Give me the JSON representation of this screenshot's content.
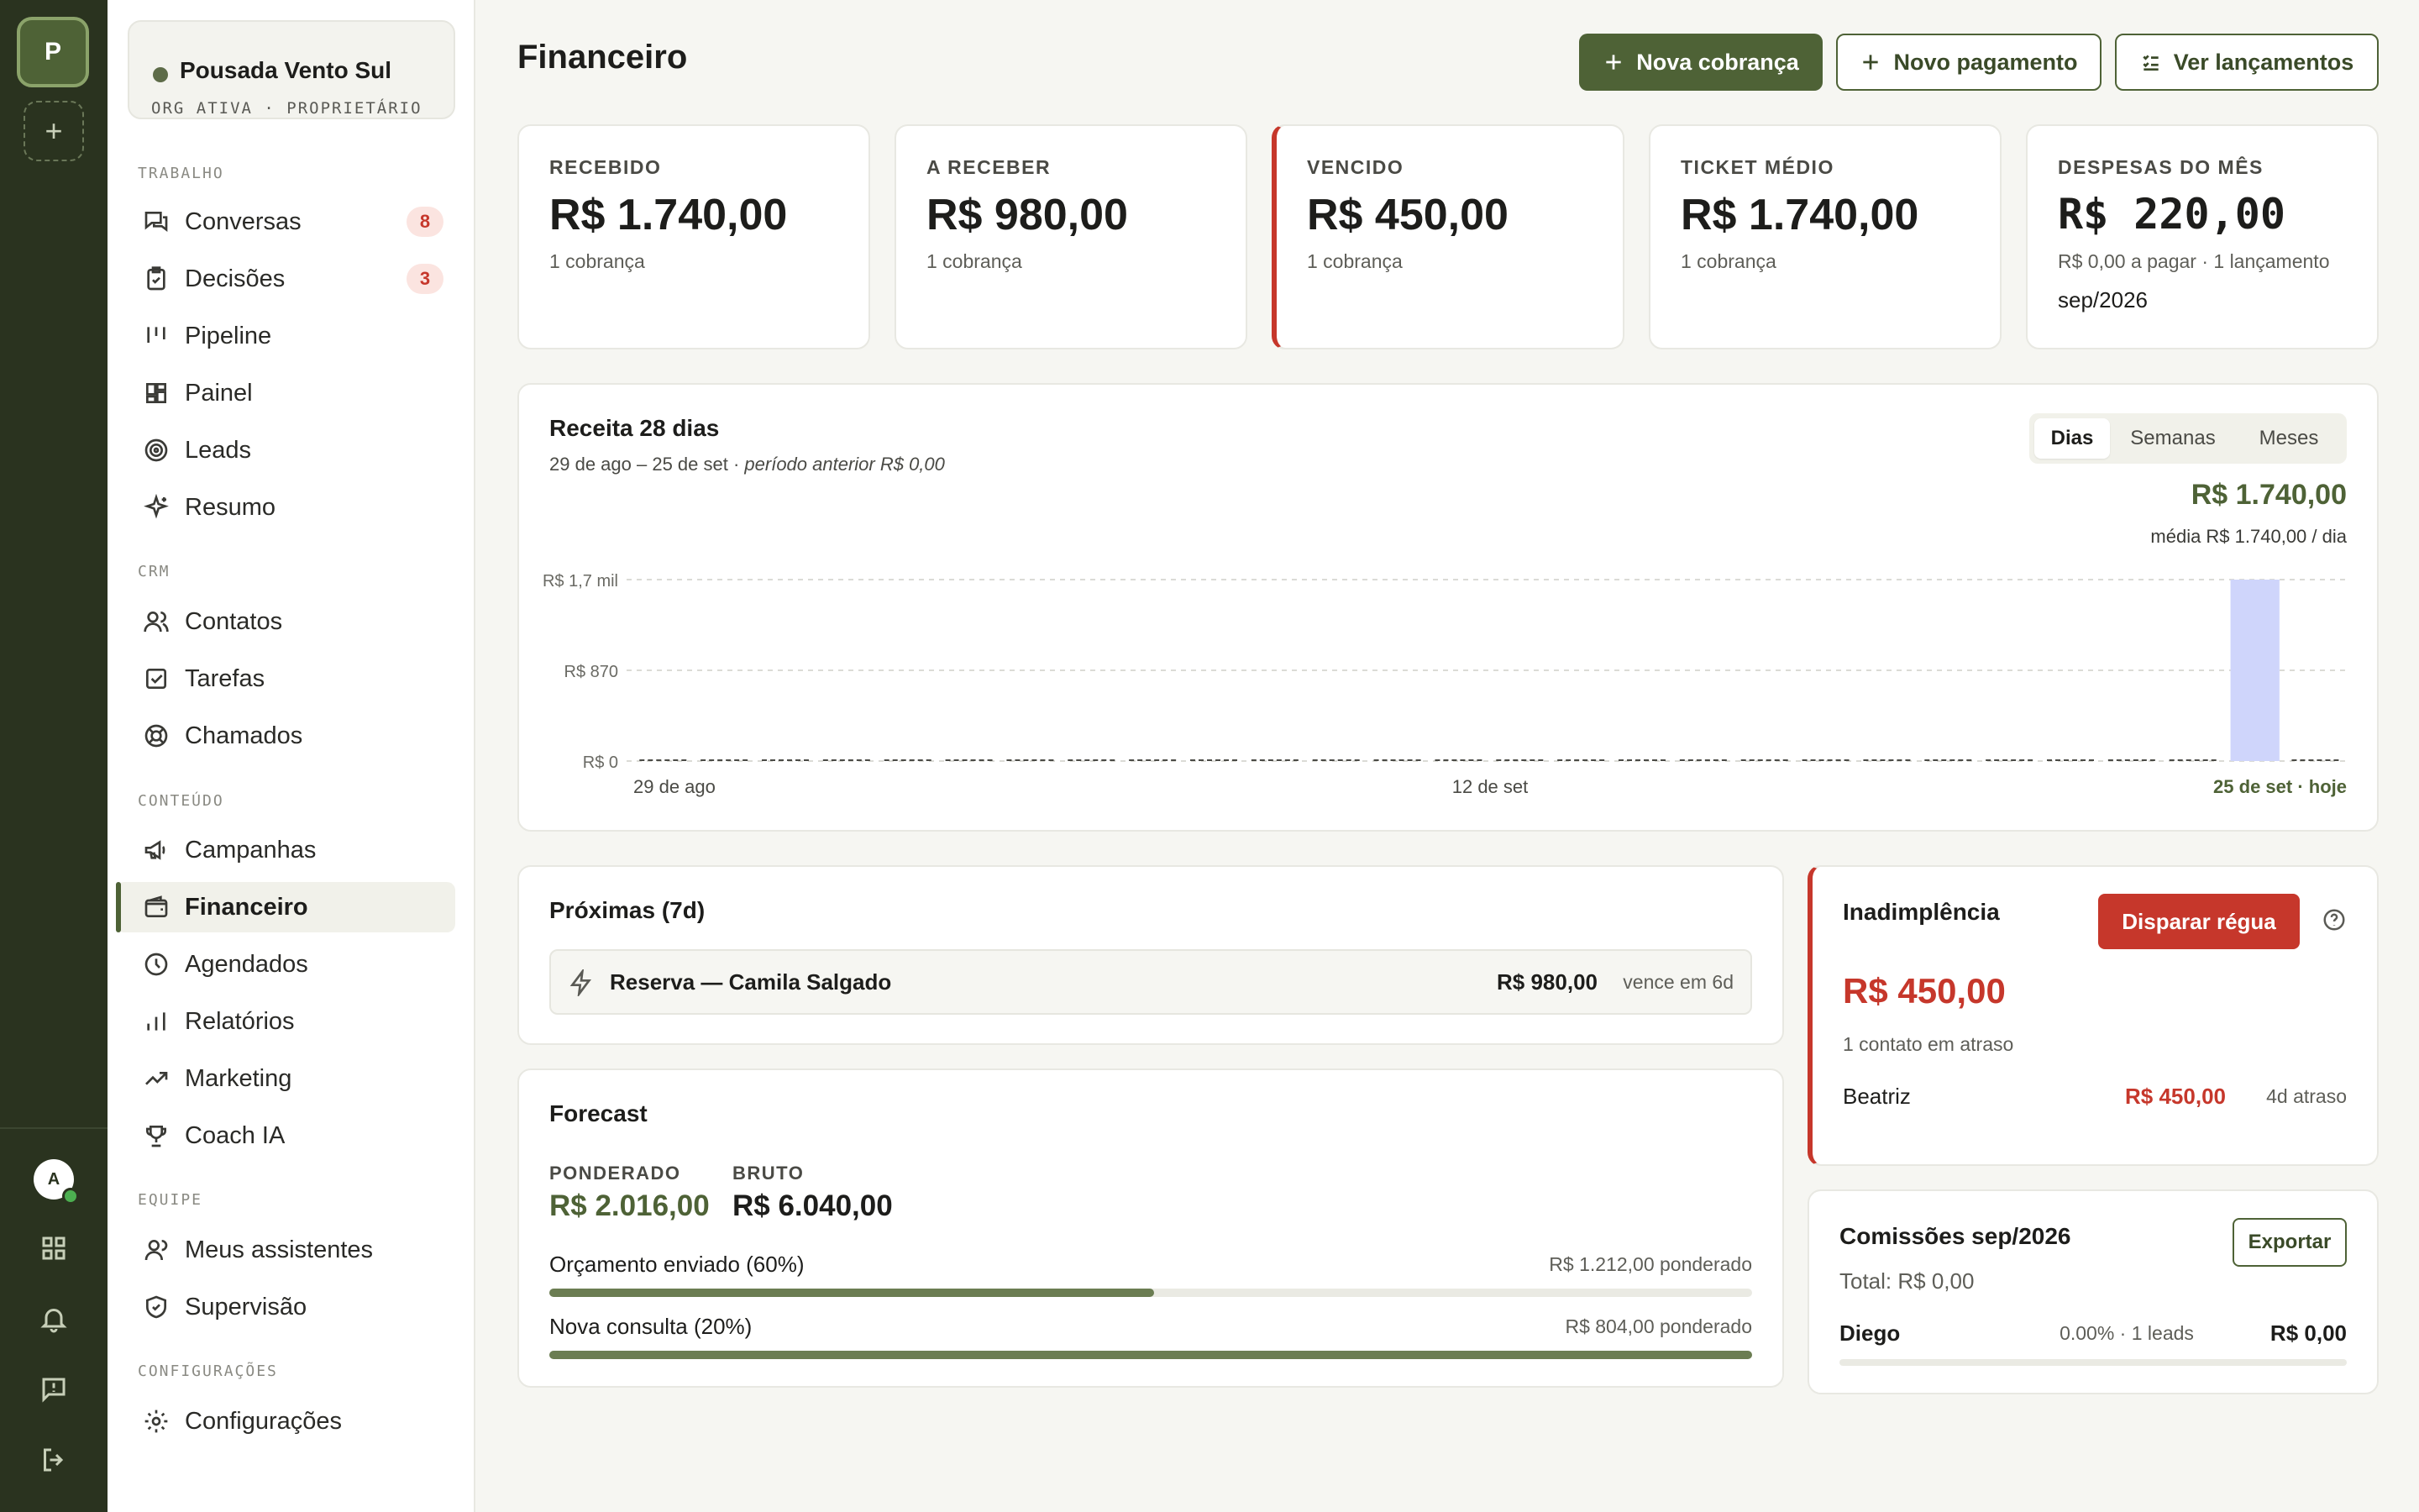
{
  "workspace": {
    "initial": "P",
    "add_label": "+"
  },
  "user": {
    "initial": "A"
  },
  "org": {
    "name": "Pousada Vento Sul",
    "meta": "ORG ATIVA · PROPRIETÁRIO"
  },
  "nav": {
    "sections": [
      "TRABALHO",
      "CRM",
      "CONTEÚDO",
      "EQUIPE",
      "CONFIGURAÇÕES"
    ],
    "items": [
      {
        "label": "Conversas",
        "icon": "chat-icon",
        "badge": "8"
      },
      {
        "label": "Decisões",
        "icon": "clipboard-icon",
        "badge": "3"
      },
      {
        "label": "Pipeline",
        "icon": "pipeline-icon"
      },
      {
        "label": "Painel",
        "icon": "dashboard-icon"
      },
      {
        "label": "Leads",
        "icon": "target-icon"
      },
      {
        "label": "Resumo",
        "icon": "sparkle-icon"
      },
      {
        "label": "Contatos",
        "icon": "users-icon"
      },
      {
        "label": "Tarefas",
        "icon": "checkbox-icon"
      },
      {
        "label": "Chamados",
        "icon": "lifebuoy-icon"
      },
      {
        "label": "Campanhas",
        "icon": "megaphone-icon"
      },
      {
        "label": "Financeiro",
        "icon": "wallet-icon",
        "active": true
      },
      {
        "label": "Agendados",
        "icon": "clock-icon"
      },
      {
        "label": "Relatórios",
        "icon": "bar-chart-icon"
      },
      {
        "label": "Marketing",
        "icon": "trending-up-icon"
      },
      {
        "label": "Coach IA",
        "icon": "trophy-icon"
      },
      {
        "label": "Meus assistentes",
        "icon": "user-icon"
      },
      {
        "label": "Supervisão",
        "icon": "shield-check-icon"
      },
      {
        "label": "Configurações",
        "icon": "gear-icon"
      }
    ]
  },
  "header": {
    "title": "Financeiro",
    "buttons": {
      "new_charge": "Nova cobrança",
      "new_payment": "Novo pagamento",
      "entries": "Ver lançamentos"
    }
  },
  "kpis": [
    {
      "label": "RECEBIDO",
      "value": "R$ 1.740,00",
      "sub": "1 cobrança"
    },
    {
      "label": "A RECEBER",
      "value": "R$ 980,00",
      "sub": "1 cobrança"
    },
    {
      "label": "VENCIDO",
      "value": "R$ 450,00",
      "sub": "1 cobrança"
    },
    {
      "label": "TICKET MÉDIO",
      "value": "R$ 1.740,00",
      "sub": "1 cobrança"
    },
    {
      "label": "DESPESAS DO MÊS",
      "value": "R$  220,00",
      "sub": "R$ 0,00 a pagar · 1 lançamento",
      "extra": "sep/2026"
    }
  ],
  "revenue": {
    "title": "Receita 28 dias",
    "range": "29 de ago – 25 de set · ",
    "previous": "período anterior R$ 0,00",
    "tabs": [
      "Dias",
      "Semanas",
      "Meses"
    ],
    "active_tab": "Dias",
    "total": "R$ 1.740,00",
    "average": "média R$ 1.740,00 / dia"
  },
  "chart_data": {
    "type": "bar",
    "title": "Receita 28 dias",
    "x_tick_labels": [
      "29 de ago",
      "12 de set",
      "25 de set · hoje"
    ],
    "y_tick_labels": [
      "R$ 1,7 mil",
      "R$ 870",
      "R$ 0"
    ],
    "ylim": [
      0,
      1740
    ],
    "days": 28,
    "values": [
      0,
      0,
      0,
      0,
      0,
      0,
      0,
      0,
      0,
      0,
      0,
      0,
      0,
      0,
      0,
      0,
      0,
      0,
      0,
      0,
      0,
      0,
      0,
      0,
      0,
      0,
      1740,
      0
    ],
    "grid": true,
    "colors": {
      "bar": "#cfd5fb",
      "baseline": "#4a4a45"
    }
  },
  "upcoming": {
    "title": "Próximas (7d)",
    "items": [
      {
        "name": "Reserva — Camila Salgado",
        "amount": "R$ 980,00",
        "due": "vence em 6d",
        "icon": "bolt-icon"
      }
    ]
  },
  "forecast": {
    "title": "Forecast",
    "weighted_label": "PONDERADO",
    "weighted_value": "R$ 2.016,00",
    "gross_label": "BRUTO",
    "gross_value": "R$ 6.040,00",
    "stages": [
      {
        "name": "Orçamento enviado (60%)",
        "value": "R$ 1.212,00 ponderado",
        "progress": 0.503
      },
      {
        "name": "Nova consulta (20%)",
        "value": "R$ 804,00 ponderado",
        "progress": 1.0
      }
    ]
  },
  "delinquency": {
    "title": "Inadimplência",
    "action": "Disparar régua",
    "total": "R$ 450,00",
    "sub": "1 contato em atraso",
    "items": [
      {
        "name": "Beatriz",
        "amount": "R$ 450,00",
        "late": "4d atraso"
      }
    ]
  },
  "commissions": {
    "title": "Comissões sep/2026",
    "total": "Total: R$ 0,00",
    "export": "Exportar",
    "items": [
      {
        "name": "Diego",
        "meta": "0.00% · 1 leads",
        "amount": "R$ 0,00",
        "progress": 0
      }
    ]
  },
  "colors": {
    "brand": "#4e6236",
    "danger": "#c6372b",
    "rail": "#2a331f",
    "accent_bar": "#cfd5fb"
  }
}
